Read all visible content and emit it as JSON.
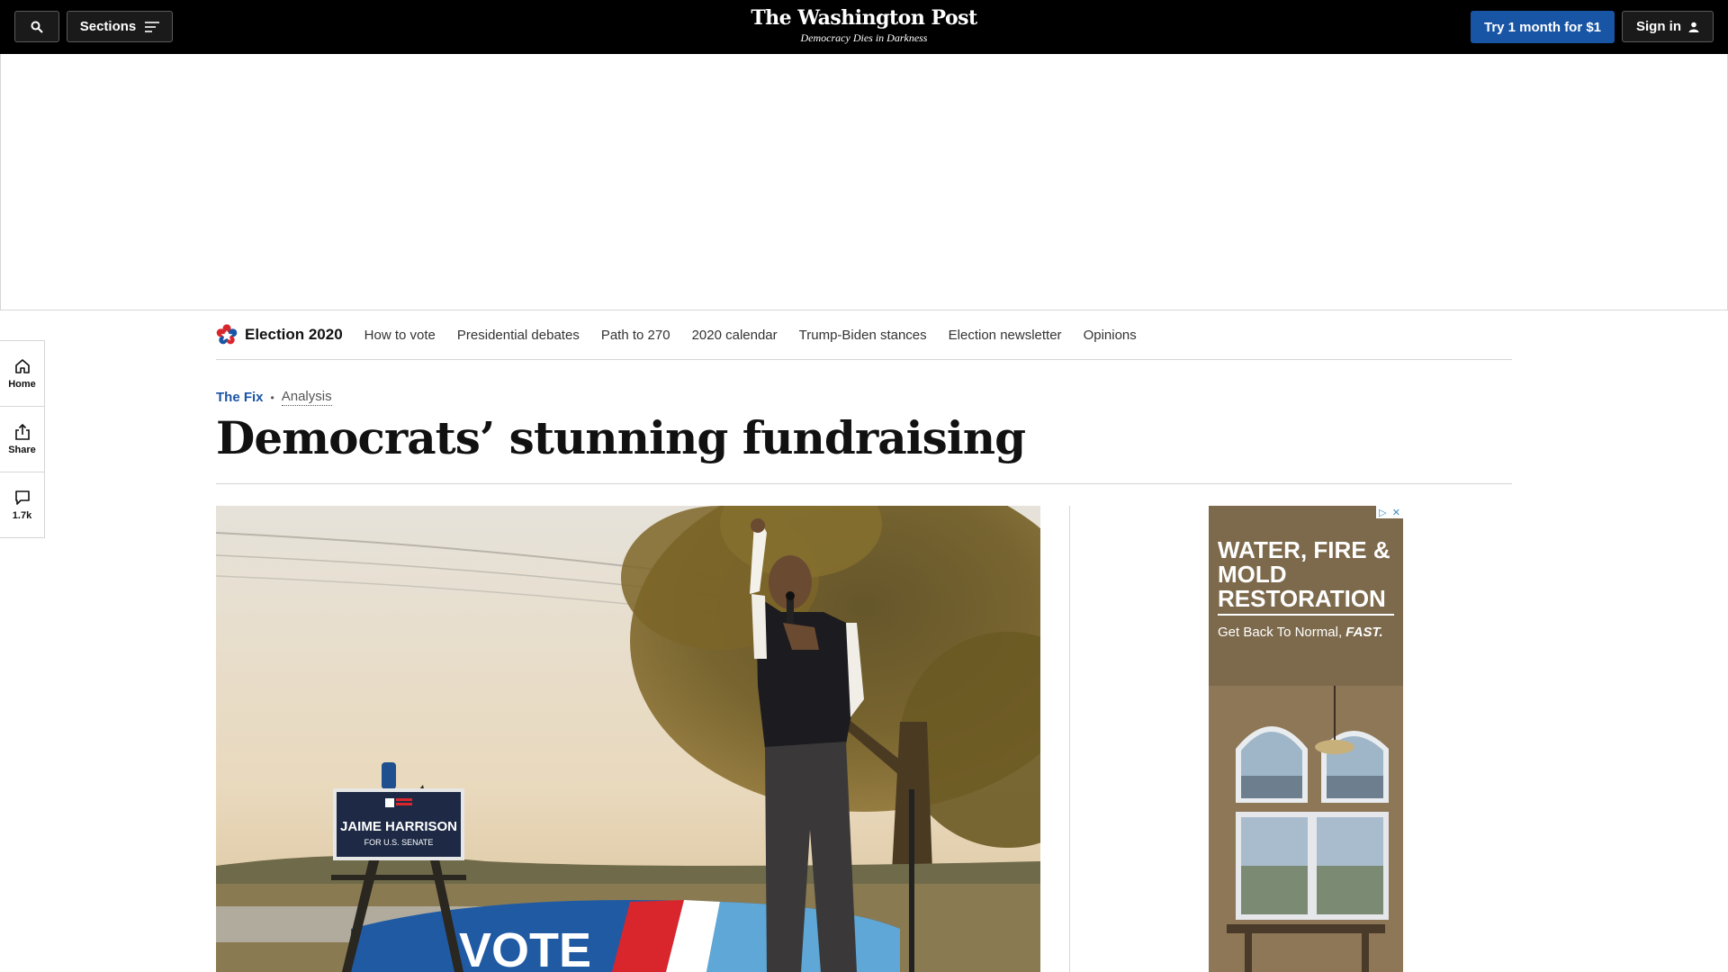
{
  "header": {
    "sections_label": "Sections",
    "logo": "The Washington Post",
    "tagline": "Democracy Dies in Darkness",
    "subscribe_label": "Try 1 month for $1",
    "signin_label": "Sign in"
  },
  "election_nav": {
    "title": "Election 2020",
    "links": [
      "How to vote",
      "Presidential debates",
      "Path to 270",
      "2020 calendar",
      "Trump-Biden stances",
      "Election newsletter",
      "Opinions"
    ]
  },
  "rail": {
    "home_label": "Home",
    "share_label": "Share",
    "comments_count": "1.7k"
  },
  "article": {
    "section": "The Fix",
    "label": "Analysis",
    "headline": "Democrats’ stunning fundraising",
    "photo": {
      "sign_name": "JAIME HARRISON",
      "sign_sub": "FOR U.S. SENATE",
      "banner_text": "VOTE"
    }
  },
  "side_ad": {
    "title": "WATER, FIRE & MOLD RESTORATION",
    "subtitle_plain": "Get Back To Normal,",
    "subtitle_emph": "FAST."
  },
  "colors": {
    "topbar": "#000000",
    "accent_blue": "#1955a5",
    "rule": "#d5d5d5"
  }
}
